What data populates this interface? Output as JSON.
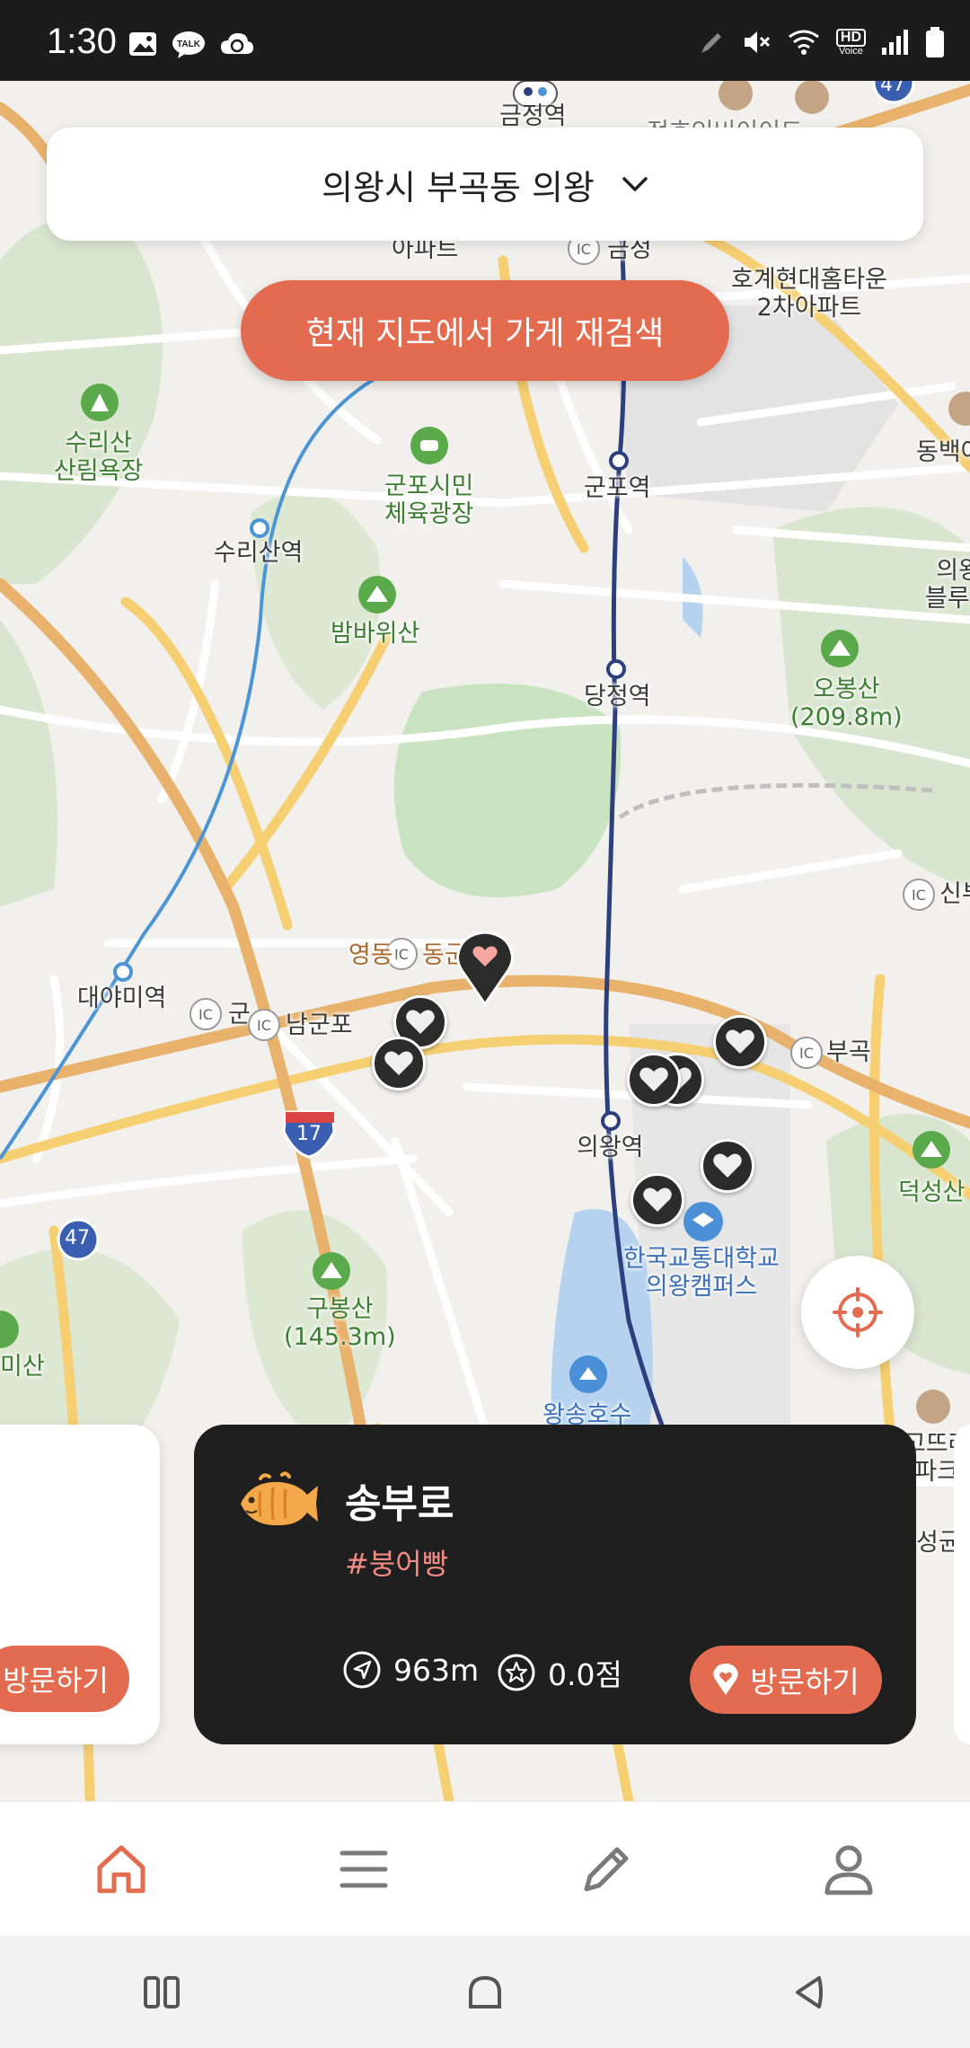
{
  "status_bar": {
    "time": "1:30",
    "left_icons": [
      "gallery-icon",
      "talk-icon",
      "cloud-sync-icon"
    ],
    "right_icons": [
      "pen-icon",
      "mute-icon",
      "wifi-icon",
      "hd-voice-icon",
      "signal-icon",
      "battery-icon"
    ],
    "hd_label": "HD",
    "voice_label": "Voice"
  },
  "location": {
    "label": "의왕시 부곡동 의왕",
    "icon": "chevron-down-icon"
  },
  "research_button": "현재 지도에서 가게 재검색",
  "map": {
    "labels": {
      "geumjeong_station": "금정역",
      "apartment_top": "아파트",
      "ic_geumjeong": "금정",
      "hogye_apt": "호계현대홈타운\n2차아파트",
      "surisan_forest": "수리산\n산림욕장",
      "gunpo_square": "군포시민\n체육광장",
      "gunpo_station": "군포역",
      "dongbaek": "동백아",
      "surisan_station": "수리산역",
      "bambawisan": "밤바위산",
      "uiwang_blue": "의왕\n블루스",
      "dangjeong_station": "당정역",
      "obongsan": "오봉산\n(209.8m)",
      "ic_sinbu": "신부",
      "yeongdong": "영동",
      "donggun": "동군",
      "daeyami_station": "대야미역",
      "gun": "군",
      "namgunpo": "남군포",
      "bugok": "부곡",
      "uiwang_station": "의왕역",
      "deokseongsan": "덕성산",
      "route_17": "17",
      "route_47_left": "47",
      "route_47_top": "47",
      "univ": "한국교통대학교\n의왕캠퍼스",
      "gubongsan": "구봉산\n(145.3m)",
      "misan": "미산",
      "wangsong_lake": "왕송호수",
      "right_apt": "고뜨레\n파크",
      "right_seong": "성균",
      "top_cut": "전호인비이이드"
    }
  },
  "card_prev": {
    "visit_label": "방문하기"
  },
  "store_card": {
    "name": "송부로",
    "tag": "#붕어빵",
    "distance": "963m",
    "rating": "0.0점",
    "visit_label": "방문하기",
    "icon": "fish-bread-icon"
  },
  "bottom_nav": {
    "items": [
      "home-icon",
      "list-icon",
      "pencil-icon",
      "profile-icon"
    ],
    "active": "home-icon"
  },
  "system_nav": [
    "recents-icon",
    "home-icon",
    "back-icon"
  ],
  "colors": {
    "accent": "#e26b50",
    "card_dark": "#1f1f1f",
    "tag_pink": "#f08c84",
    "marker_dark": "#2b2b2b"
  }
}
